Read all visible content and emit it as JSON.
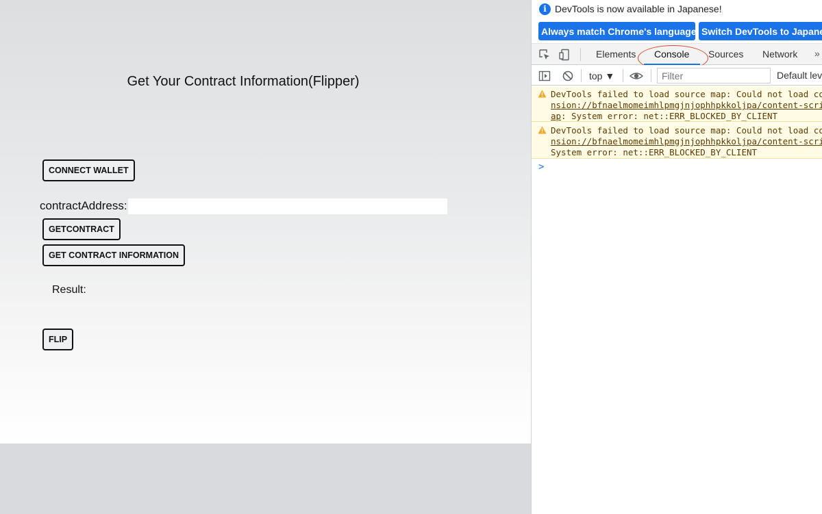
{
  "app": {
    "title": "Get Your Contract Information(Flipper)",
    "connect_button": "CONNECT WALLET",
    "address_label": "contractAddress:",
    "address_value": "",
    "getcontract_button": "GETCONTRACT",
    "getinfo_button": "GET CONTRACT INFORMATION",
    "result_label": "Result:",
    "flip_button": "FLIP"
  },
  "devtools": {
    "notice": "DevTools is now available in Japanese!",
    "lang_buttons": [
      "Always match Chrome's language",
      "Switch DevTools to Japanese"
    ],
    "tabs": [
      "Elements",
      "Console",
      "Sources",
      "Network"
    ],
    "active_tab": "Console",
    "more_tabs": "»",
    "context": "top ▼",
    "filter_placeholder": "Filter",
    "levels": "Default levels",
    "accent_color": "#1a73e8",
    "highlight_color": "#d44a2a",
    "messages": [
      {
        "lines": [
          "DevTools failed to load source map: Could not load content for chrome-exte",
          "nsion://bfnaelmomeimhlpmgjnjophhpkkoljpa/content-script.js.map",
          "ap",
          ": System error: net::ERR_BLOCKED_BY_CLIENT"
        ]
      },
      {
        "lines": [
          "DevTools failed to load source map: Could not load content for chrome-exte",
          "nsion://bfnaelmomeimhlpmgjnjophhpkkoljpa/content-script.js.map",
          "System error: net::ERR_BLOCKED_BY_CLIENT"
        ]
      }
    ],
    "prompt": ">"
  }
}
